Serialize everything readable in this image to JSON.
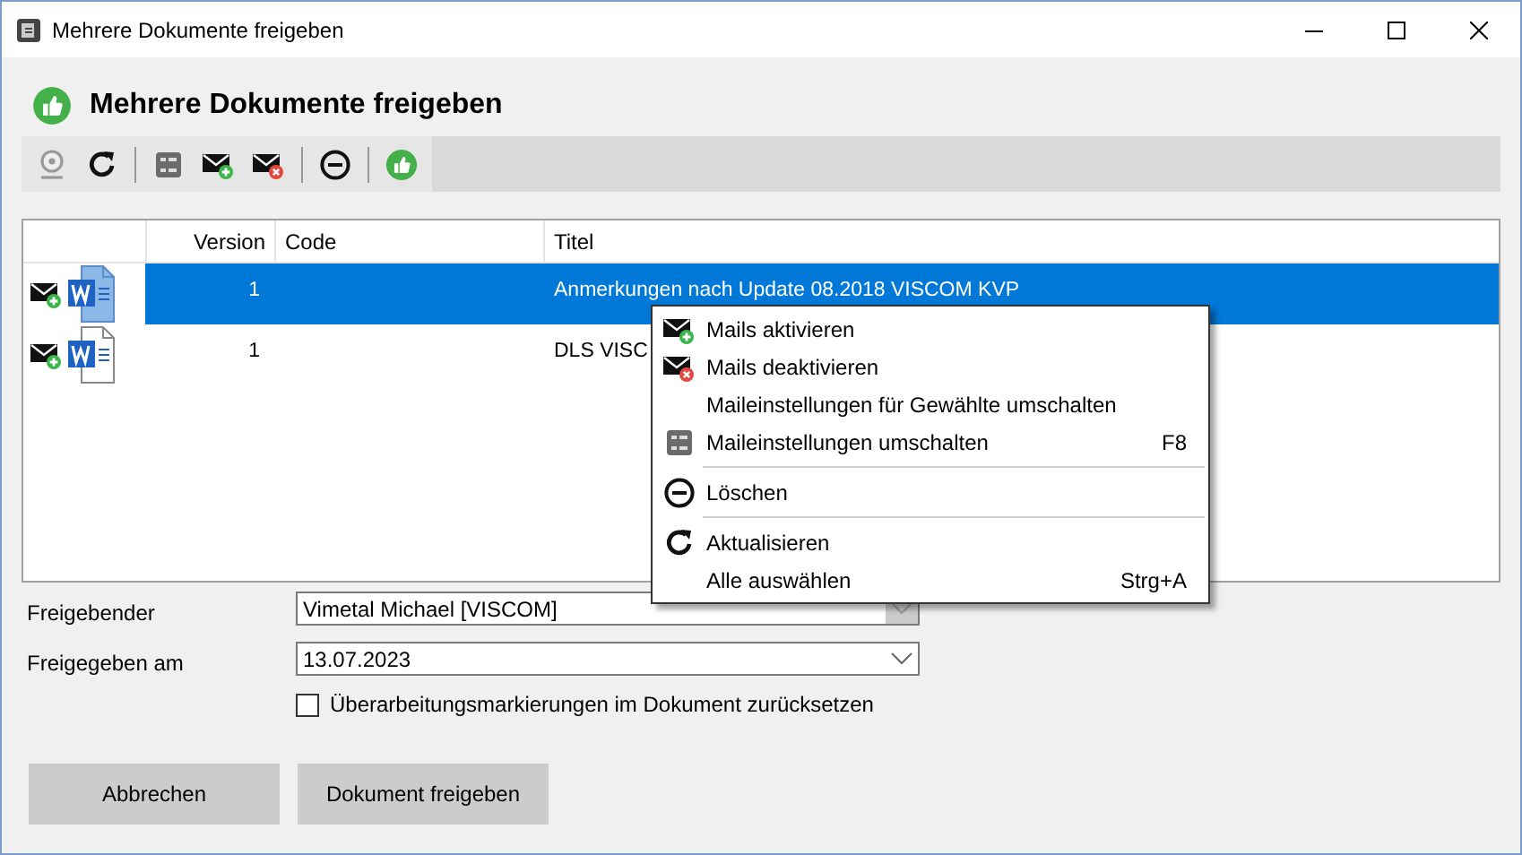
{
  "window": {
    "title": "Mehrere Dokumente freigeben"
  },
  "header": {
    "title": "Mehrere Dokumente freigeben"
  },
  "toolbar": {
    "buttons": [
      {
        "kind": "disc"
      },
      {
        "kind": "refresh"
      },
      {
        "kind": "separator"
      },
      {
        "kind": "toggle"
      },
      {
        "kind": "mail-add"
      },
      {
        "kind": "mail-remove"
      },
      {
        "kind": "separator"
      },
      {
        "kind": "delete"
      },
      {
        "kind": "separator"
      },
      {
        "kind": "approve"
      }
    ]
  },
  "grid": {
    "columns": [
      "Version",
      "Code",
      "Titel"
    ],
    "rows": [
      {
        "mail_enabled": true,
        "version": "1",
        "title": "Anmerkungen nach Update 08.2018 VISCOM KVP",
        "selected": true
      },
      {
        "mail_enabled": true,
        "version": "1",
        "title": "DLS VISC",
        "selected": false
      }
    ]
  },
  "context_menu": {
    "items": [
      {
        "kind": "mail-add",
        "label": "Mails aktivieren"
      },
      {
        "kind": "mail-remove",
        "label": "Mails deaktivieren"
      },
      {
        "kind": "text",
        "label": "Maileinstellungen für Gewählte umschalten"
      },
      {
        "kind": "toggle",
        "label": "Maileinstellungen umschalten",
        "shortcut": "F8"
      },
      {
        "kind": "separator"
      },
      {
        "kind": "delete",
        "label": "Löschen"
      },
      {
        "kind": "separator"
      },
      {
        "kind": "refresh",
        "label": "Aktualisieren"
      },
      {
        "kind": "text",
        "label": "Alle auswählen",
        "shortcut": "Strg+A"
      }
    ]
  },
  "form": {
    "fields": [
      {
        "label": "Freigebender",
        "value": "Vimetal Michael [VISCOM]",
        "disabled": true
      },
      {
        "label": "Freigegeben am",
        "value": "13.07.2023",
        "disabled": false
      }
    ],
    "checkbox": {
      "label": "Überarbeitungsmarkierungen im Dokument zurücksetzen",
      "checked": false
    },
    "buttons": [
      "Abbrechen",
      "Dokument freigeben"
    ]
  }
}
